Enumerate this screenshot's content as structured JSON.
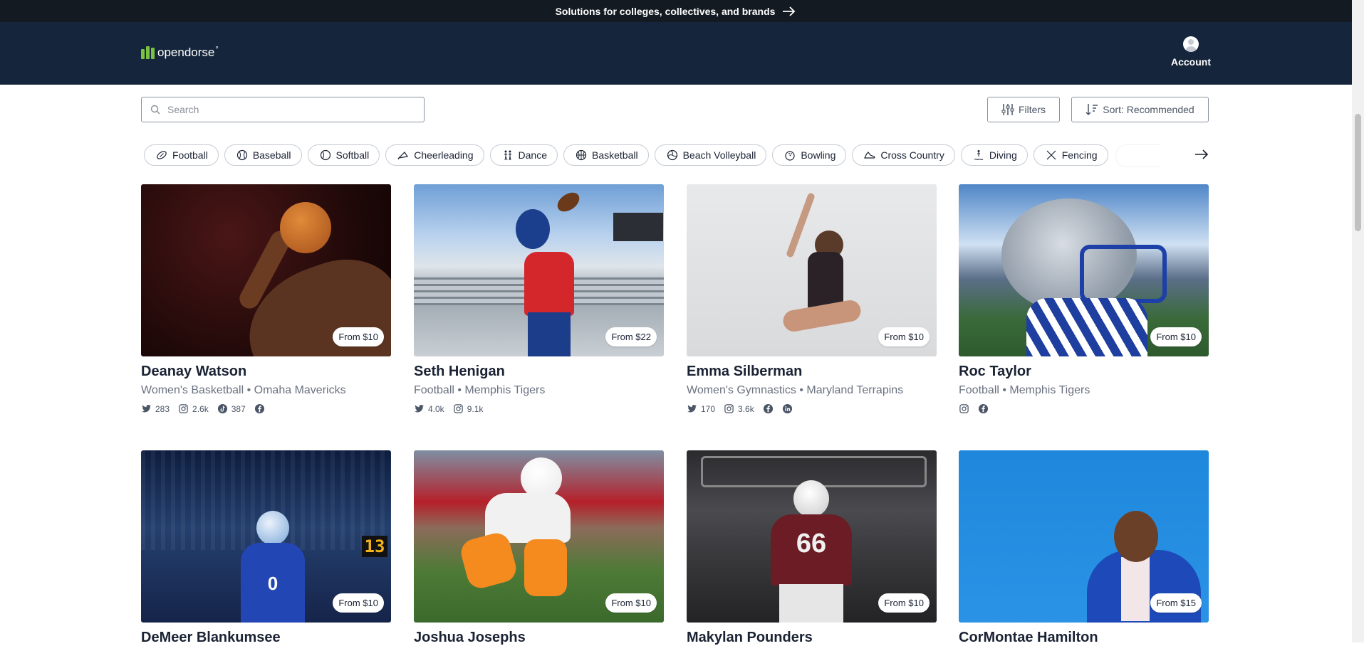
{
  "promo": {
    "text": "Solutions for colleges, collectives, and brands"
  },
  "header": {
    "logo_text": "opendorse",
    "logo_tm": "°",
    "account_label": "Account"
  },
  "search": {
    "placeholder": "Search"
  },
  "controls": {
    "filters_label": "Filters",
    "sort_label": "Sort: Recommended"
  },
  "sports": [
    {
      "label": "Football",
      "icon": "football-icon"
    },
    {
      "label": "Baseball",
      "icon": "baseball-icon"
    },
    {
      "label": "Softball",
      "icon": "softball-icon"
    },
    {
      "label": "Cheerleading",
      "icon": "cheerleading-icon"
    },
    {
      "label": "Dance",
      "icon": "dance-icon"
    },
    {
      "label": "Basketball",
      "icon": "basketball-icon"
    },
    {
      "label": "Beach Volleyball",
      "icon": "volleyball-icon"
    },
    {
      "label": "Bowling",
      "icon": "bowling-icon"
    },
    {
      "label": "Cross Country",
      "icon": "running-shoe-icon"
    },
    {
      "label": "Diving",
      "icon": "diving-icon"
    },
    {
      "label": "Fencing",
      "icon": "fencing-icon"
    }
  ],
  "athletes": [
    {
      "name": "Deanay Watson",
      "meta": "Women's Basketball • Omaha Mavericks",
      "price": "From $10",
      "socials": {
        "twitter": "283",
        "instagram": "2.6k",
        "tiktok": "387",
        "facebook": ""
      }
    },
    {
      "name": "Seth Henigan",
      "meta": "Football • Memphis Tigers",
      "price": "From $22",
      "socials": {
        "twitter": "4.0k",
        "instagram": "9.1k"
      }
    },
    {
      "name": "Emma Silberman",
      "meta": "Women's Gymnastics • Maryland Terrapins",
      "price": "From $10",
      "socials": {
        "twitter": "170",
        "instagram": "3.6k",
        "facebook": "",
        "linkedin": ""
      }
    },
    {
      "name": "Roc Taylor",
      "meta": "Football • Memphis Tigers",
      "price": "From $10",
      "socials": {
        "instagram": "",
        "facebook": ""
      }
    },
    {
      "name": "DeMeer Blankumsee",
      "meta": "",
      "price": "From $10",
      "jersey": "0",
      "scoreboard": "13"
    },
    {
      "name": "Joshua Josephs",
      "meta": "",
      "price": "From $10"
    },
    {
      "name": "Makylan Pounders",
      "meta": "",
      "price": "From $10",
      "jersey": "66"
    },
    {
      "name": "CorMontae Hamilton",
      "meta": "",
      "price": "From $15"
    }
  ],
  "colors": {
    "header_bg": "#15253b",
    "promo_bg": "#141a22",
    "brand_green": "#7cc242"
  }
}
